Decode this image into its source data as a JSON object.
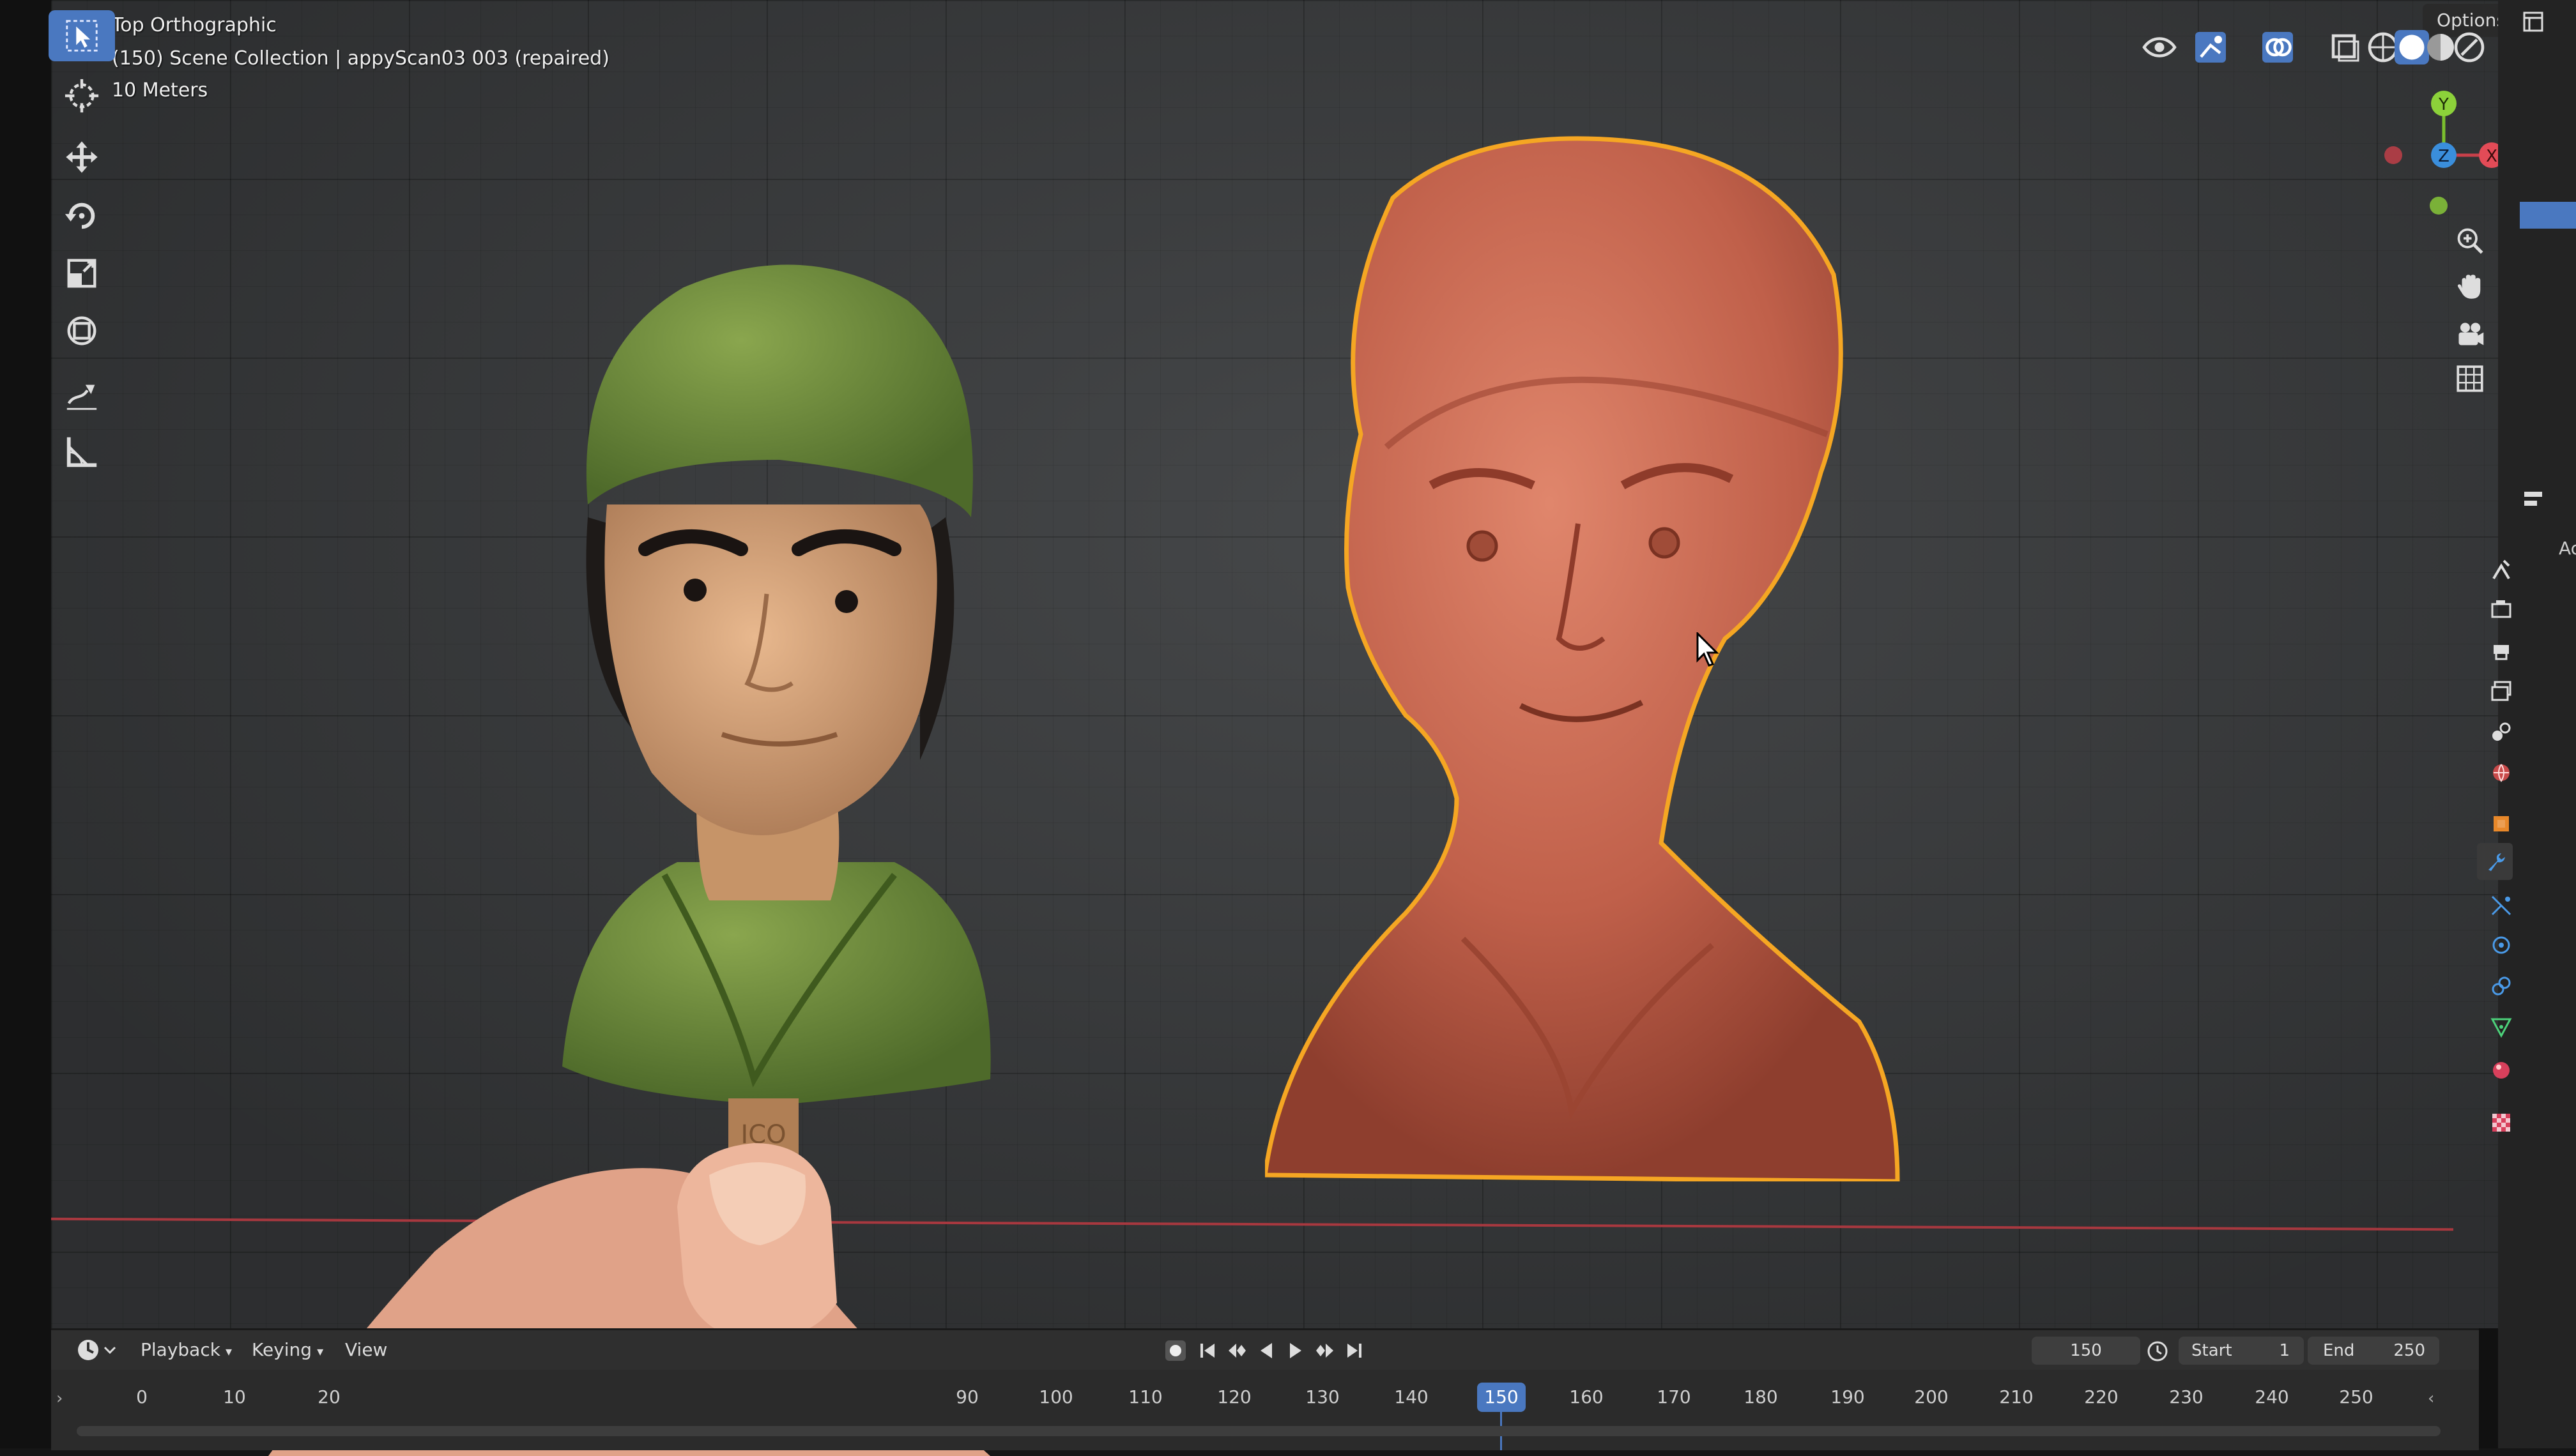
{
  "viewport": {
    "view_name": "Top Orthographic",
    "collection_line": "(150) Scene Collection | appyScan03 003 (repaired)",
    "scale_text": "10 Meters",
    "options_label": "Options",
    "ac_label": "Ac"
  },
  "tools": [
    {
      "name": "select-box-tool",
      "icon": "cursor-arrow-icon",
      "active": true
    },
    {
      "name": "cursor-tool",
      "icon": "crosshair-icon"
    },
    {
      "name": "move-tool",
      "icon": "move-arrows-icon"
    },
    {
      "name": "rotate-tool",
      "icon": "rotate-icon"
    },
    {
      "name": "scale-tool",
      "icon": "scale-icon"
    },
    {
      "name": "transform-tool",
      "icon": "transform-icon"
    },
    {
      "name": "annotate-tool",
      "icon": "pencil-icon"
    },
    {
      "name": "measure-tool",
      "icon": "ruler-icon"
    }
  ],
  "gizmo": {
    "y_label": "Y",
    "z_label": "Z",
    "x_label": "X"
  },
  "timeline": {
    "menus": [
      {
        "label": "Playback"
      },
      {
        "label": "Keying"
      },
      {
        "label": "View"
      }
    ],
    "current_frame": "150",
    "start_label": "Start",
    "start_value": "1",
    "end_label": "End",
    "end_value": "250",
    "ticks_left": [
      "0",
      "10",
      "20"
    ],
    "ticks_right": [
      "90",
      "100",
      "110",
      "120",
      "130",
      "140",
      "150",
      "160",
      "170",
      "180",
      "190",
      "200",
      "210",
      "220",
      "230",
      "240",
      "250"
    ],
    "handle_label": "ICO"
  },
  "colors": {
    "accent": "#4a78c0",
    "selection_outline": "#f5a623",
    "scan_mesh": "#c0604a",
    "clay_green": "#6f8a3e",
    "clay_skin": "#d8a47c",
    "x_axis": "#a8383f"
  }
}
